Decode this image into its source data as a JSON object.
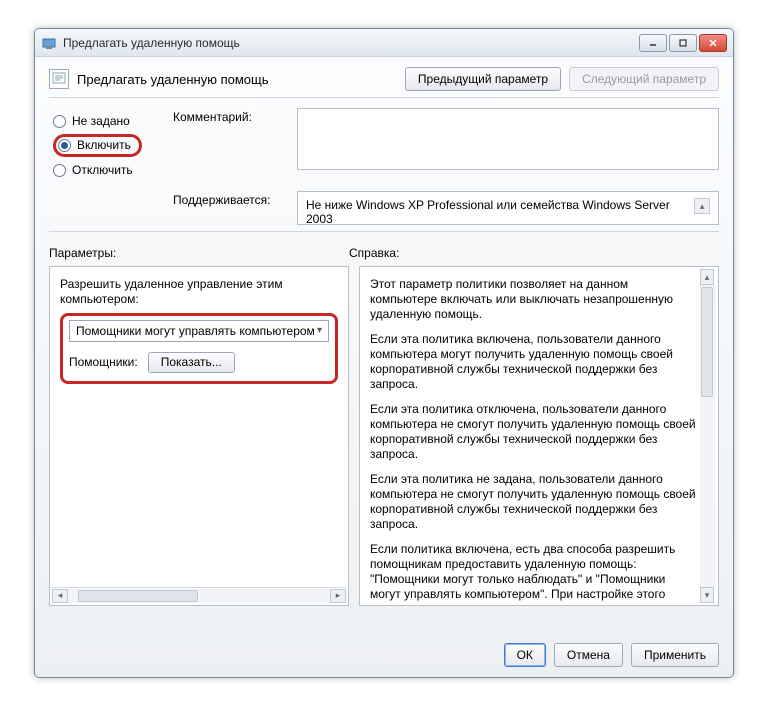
{
  "window": {
    "title": "Предлагать удаленную помощь"
  },
  "header": {
    "title": "Предлагать удаленную помощь",
    "prev": "Предыдущий параметр",
    "next": "Следующий параметр"
  },
  "radios": {
    "not_configured": "Не задано",
    "enabled": "Включить",
    "disabled": "Отключить"
  },
  "labels": {
    "comment": "Комментарий:",
    "supported": "Поддерживается:",
    "params": "Параметры:",
    "help": "Справка:",
    "allow_remote": "Разрешить удаленное управление этим компьютером:",
    "helpers": "Помощники:"
  },
  "supported_text": "Не ниже Windows XP Professional или семейства Windows Server 2003",
  "select_value": "Помощники могут управлять компьютером",
  "show_btn": "Показать...",
  "help_paragraphs": [
    "Этот параметр политики позволяет на данном компьютере включать или выключать незапрошенную удаленную помощь.",
    "Если эта политика включена, пользователи данного компьютера могут получить удаленную помощь своей корпоративной службы технической поддержки без запроса.",
    "Если эта политика отключена, пользователи данного компьютера не смогут получить удаленную помощь своей корпоративной службы технической поддержки без запроса.",
    "Если эта политика не задана, пользователи данного компьютера не смогут получить удаленную помощь своей корпоративной службы технической поддержки без запроса.",
    "Если политика включена, есть два способа разрешить помощникам предоставить удаленную помощь: \"Помощники могут только наблюдать\" и \"Помощники могут управлять компьютером\". При настройке этого параметра"
  ],
  "footer": {
    "ok": "ОК",
    "cancel": "Отмена",
    "apply": "Применить"
  }
}
